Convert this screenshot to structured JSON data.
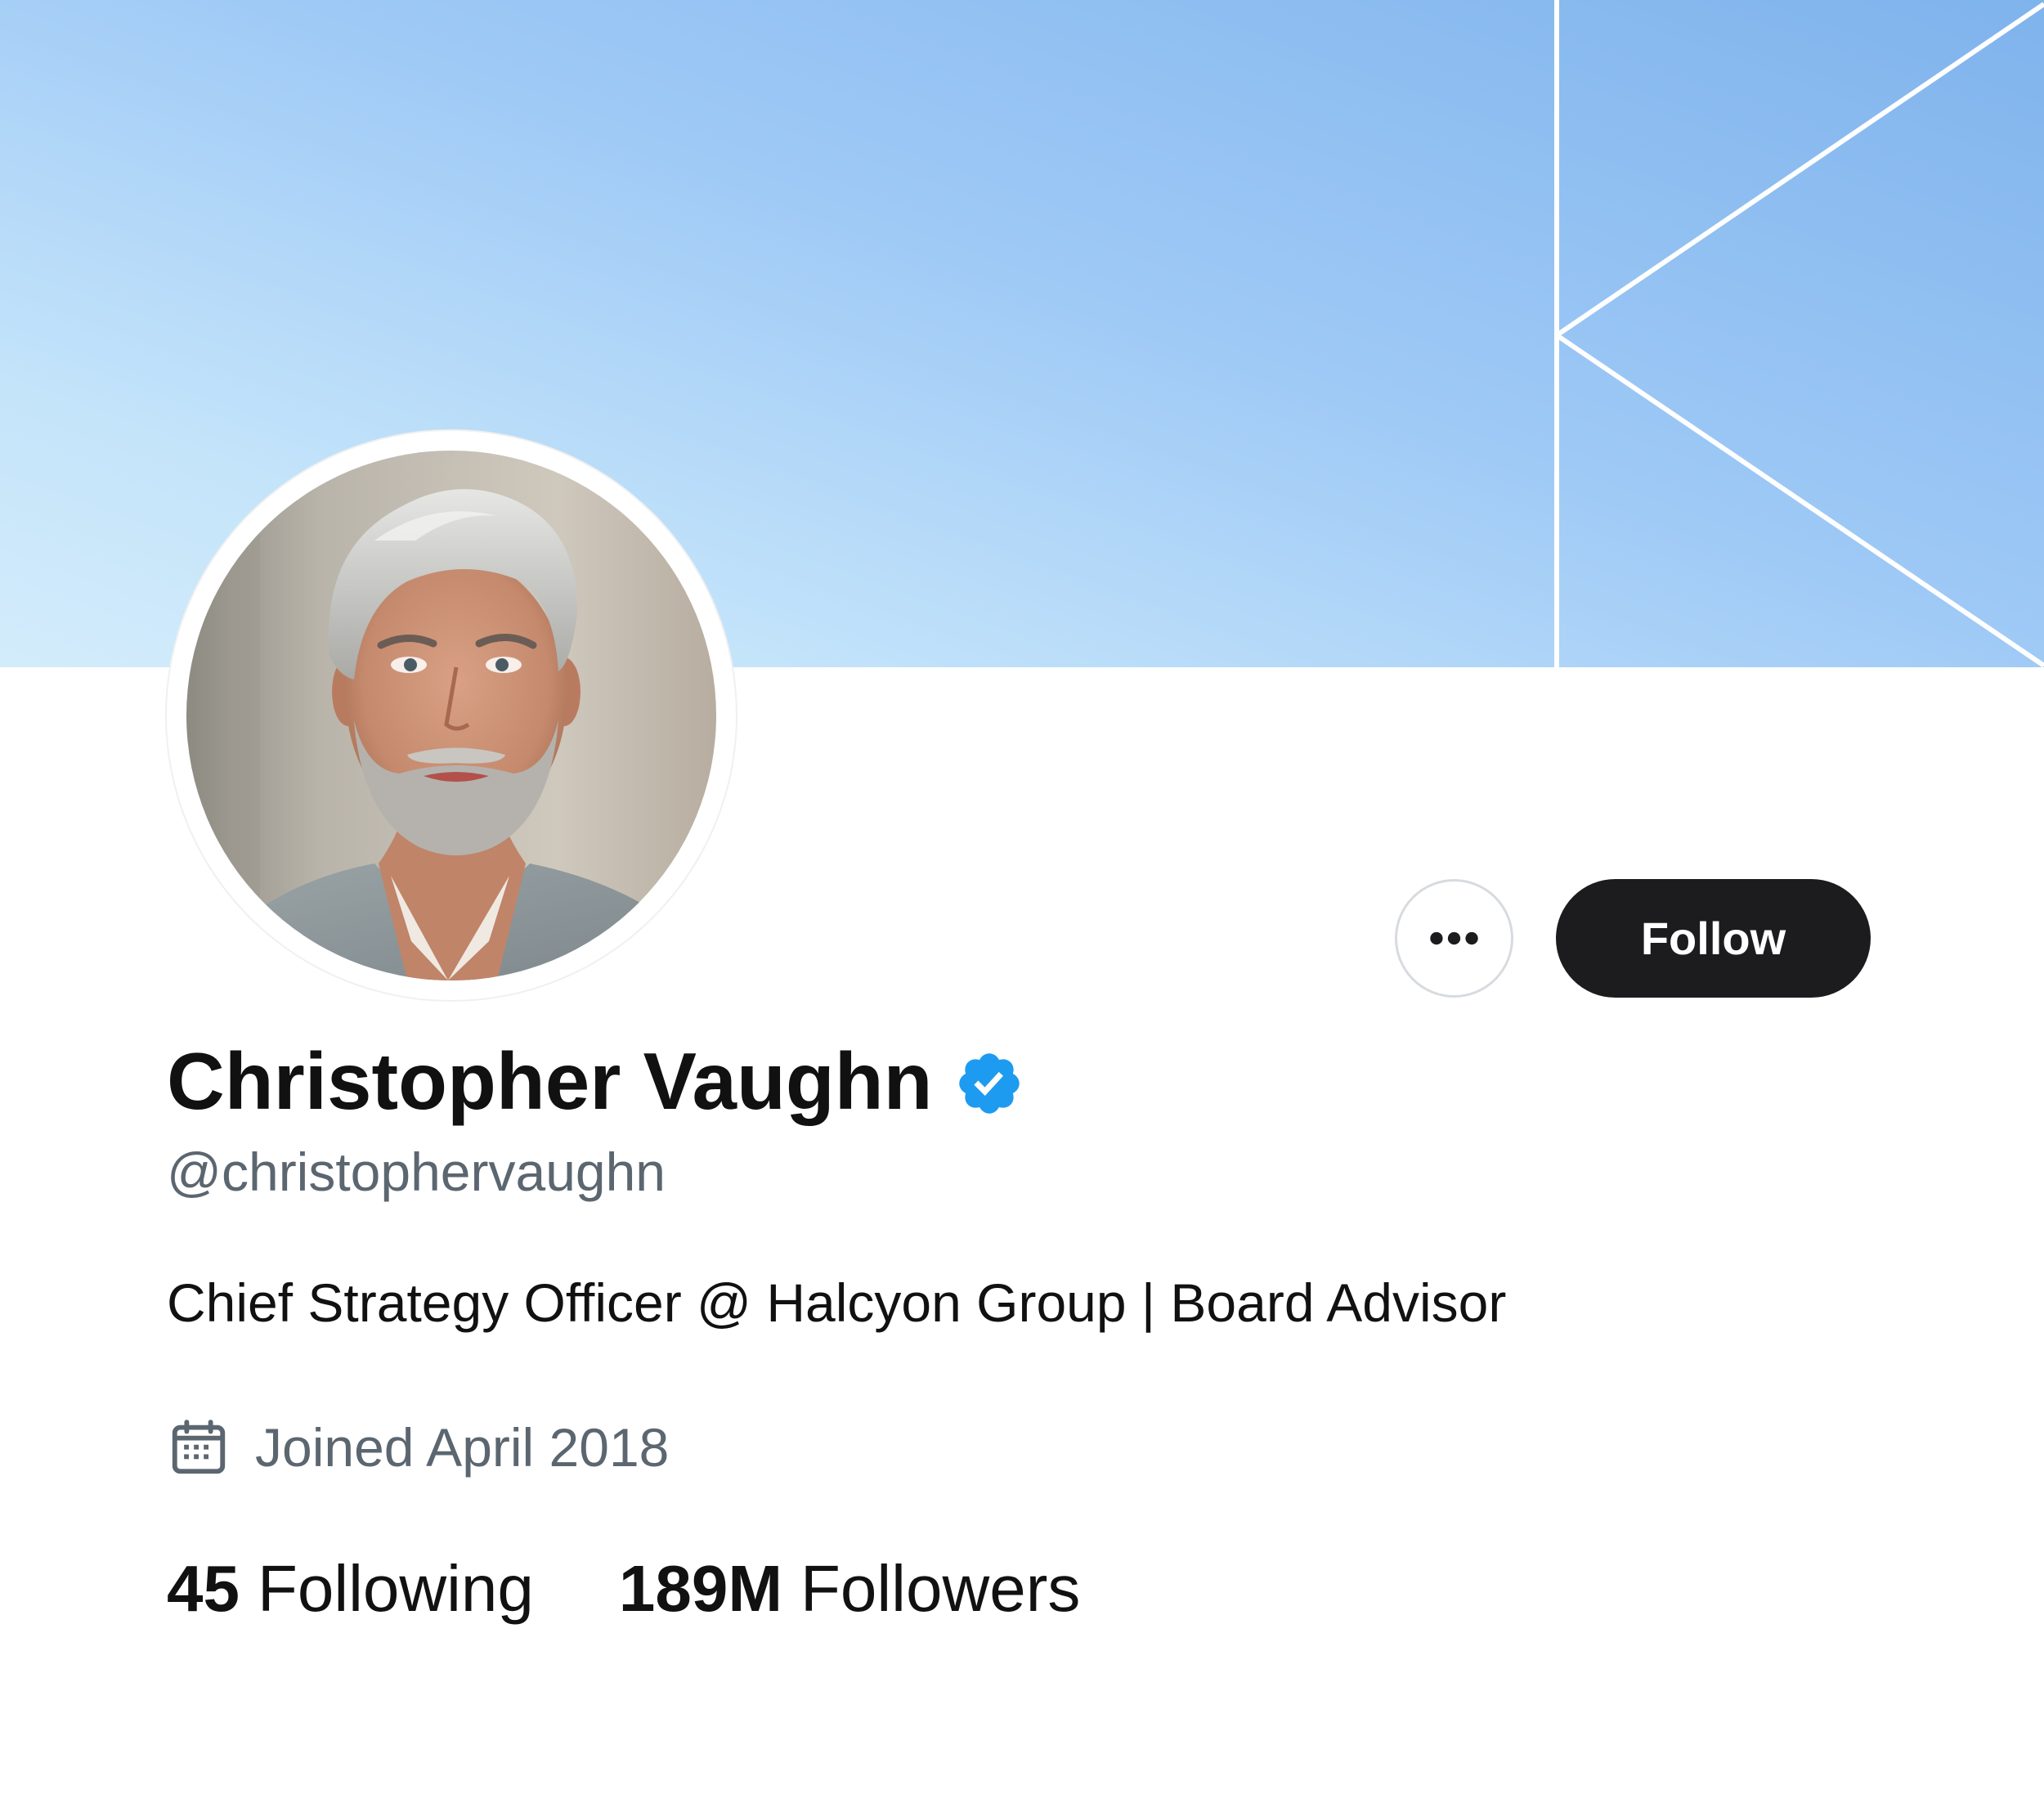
{
  "profile": {
    "display_name": "Christopher Vaughn",
    "handle": "@christophervaughn",
    "bio": "Chief Strategy Officer @ Halcyon Group | Board Advisor",
    "joined": "Joined April 2018",
    "verified": true
  },
  "actions": {
    "more_icon": "ellipsis-icon",
    "follow_label": "Follow"
  },
  "stats": {
    "following_count": "45",
    "following_label": "Following",
    "followers_count": "189M",
    "followers_label": "Followers"
  },
  "icons": {
    "verified": "verified-badge-icon",
    "joined": "calendar-icon"
  },
  "colors": {
    "verified_badge": "#1d9bf0",
    "follow_button_bg": "#1c1c1e",
    "secondary_text": "#5b6670",
    "primary_text": "#111111"
  }
}
